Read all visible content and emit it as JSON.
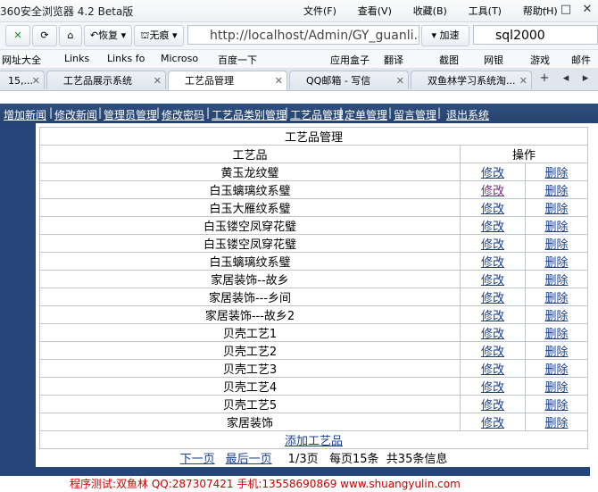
{
  "browser": {
    "title": "360安全浏览器 4.2 Beta版",
    "menu": [
      "文件(F)",
      "查看(V)",
      "收藏(B)",
      "工具(T)",
      "帮助(H)"
    ],
    "nav_buttons": {
      "restore": "恢复",
      "incognito": "无痕",
      "accelerate": "加速"
    },
    "address": "http://localhost/Admin/GY_guanli.asp",
    "search": "sql2000",
    "bookmarks": [
      "网址大全",
      "Links",
      "Links fo",
      "Microso",
      "百度一下",
      "应用盒子",
      "翻译",
      "截图",
      "网银",
      "游戏",
      "邮件"
    ],
    "tabs": [
      {
        "label": "15,..."
      },
      {
        "label": "工艺品展示系统"
      },
      {
        "label": "工艺品管理",
        "active": true
      },
      {
        "label": "QQ邮箱 - 写信"
      },
      {
        "label": "双鱼林学习系统淘..."
      }
    ]
  },
  "nav": [
    "增加新闻",
    "修改新闻",
    "管理员管理",
    "修改密码",
    "工艺品类别管理",
    "工艺品管理",
    "定单管理",
    "留言管理",
    "退出系统"
  ],
  "page": {
    "title": "工艺品管理",
    "col_name": "工艺品",
    "col_ops": "操作",
    "edit": "修改",
    "delete": "删除",
    "rows": [
      "黄玉龙纹璧",
      "白玉螭璃纹系璧",
      "白玉大雁纹系璧",
      "白玉镂空凤穿花璧",
      "白玉镂空凤穿花璧",
      "白玉螭璃纹系璧",
      "家居装饰--故乡",
      "家居装饰---乡间",
      "家居装饰---故乡2",
      "贝壳工艺1",
      "贝壳工艺2",
      "贝壳工艺3",
      "贝壳工艺4",
      "贝壳工艺5",
      "家居装饰"
    ],
    "add": "添加工艺品",
    "next": "下一页",
    "last": "最后一页",
    "page_info": "1/3页   每页15条  共35条信息"
  },
  "footer": "程序测试:双鱼林 QQ:287307421 手机:13558690869 www.shuangyulin.com"
}
